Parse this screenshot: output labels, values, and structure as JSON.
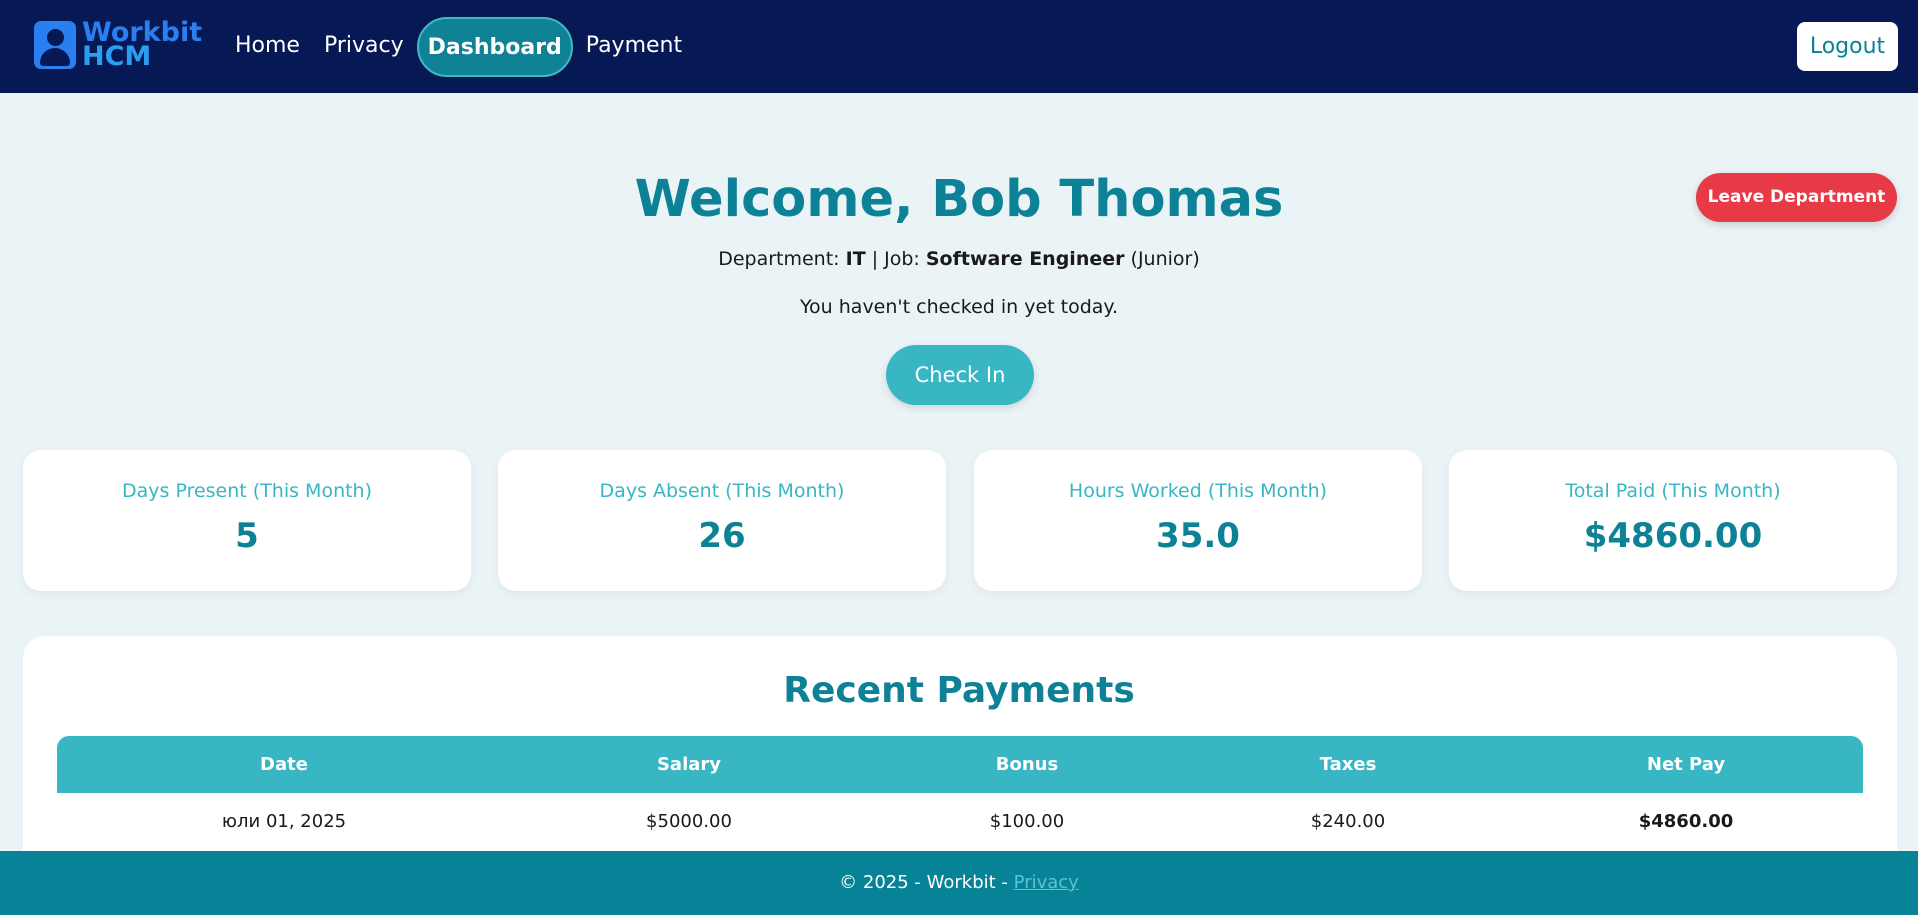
{
  "navbar": {
    "brand_line1": "Workbit",
    "brand_line2": "HCM",
    "links": [
      {
        "label": "Home"
      },
      {
        "label": "Privacy"
      },
      {
        "label": "Dashboard",
        "active": true
      },
      {
        "label": "Payment"
      }
    ],
    "logout_label": "Logout"
  },
  "welcome": {
    "title": "Welcome, Bob Thomas",
    "department_prefix": "Department: ",
    "department": "IT",
    "job_prefix": " | Job: ",
    "job": "Software Engineer",
    "level": " (Junior)",
    "checkin_status": "You haven't checked in yet today.",
    "checkin_button": "Check In",
    "leave_button": "Leave Department"
  },
  "stats": [
    {
      "label": "Days Present (This Month)",
      "value": "5"
    },
    {
      "label": "Days Absent (This Month)",
      "value": "26"
    },
    {
      "label": "Hours Worked (This Month)",
      "value": "35.0"
    },
    {
      "label": "Total Paid (This Month)",
      "value": "$4860.00"
    }
  ],
  "payments": {
    "title": "Recent Payments",
    "columns": [
      "Date",
      "Salary",
      "Bonus",
      "Taxes",
      "Net Pay"
    ],
    "rows": [
      {
        "date": "юли 01, 2025",
        "salary": "$5000.00",
        "bonus": "$100.00",
        "taxes": "$240.00",
        "net": "$4860.00"
      }
    ]
  },
  "footer": {
    "text": "© 2025 - Workbit - ",
    "privacy_link": "Privacy"
  },
  "colors": {
    "navbar_bg": "#071955",
    "accent": "#0d8296",
    "accent_light": "#38b6c4",
    "danger": "#e73946",
    "page_bg": "#eaf3f6"
  }
}
